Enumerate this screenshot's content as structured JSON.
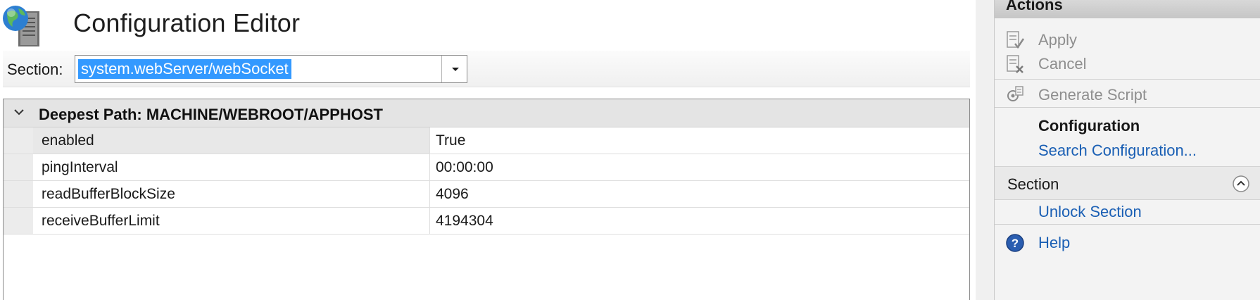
{
  "header": {
    "title": "Configuration Editor",
    "icon": "server-globe-icon"
  },
  "section_selector": {
    "label": "Section:",
    "value": "system.webServer/webSocket",
    "dropdown_icon": "chevron-down-icon"
  },
  "grid": {
    "group_label": "Deepest Path: MACHINE/WEBROOT/APPHOST",
    "rows": [
      {
        "name": "enabled",
        "value": "True"
      },
      {
        "name": "pingInterval",
        "value": "00:00:00"
      },
      {
        "name": "readBufferBlockSize",
        "value": "4096"
      },
      {
        "name": "receiveBufferLimit",
        "value": "4194304"
      }
    ]
  },
  "actions": {
    "title": "Actions",
    "apply": "Apply",
    "cancel": "Cancel",
    "generate_script": "Generate Script",
    "configuration_heading": "Configuration",
    "search_configuration": "Search Configuration...",
    "section_group": "Section",
    "unlock_section": "Unlock Section",
    "help": "Help"
  },
  "colors": {
    "selection": "#3399ff",
    "link": "#1a5fb4",
    "disabled": "#8e8e8e"
  }
}
